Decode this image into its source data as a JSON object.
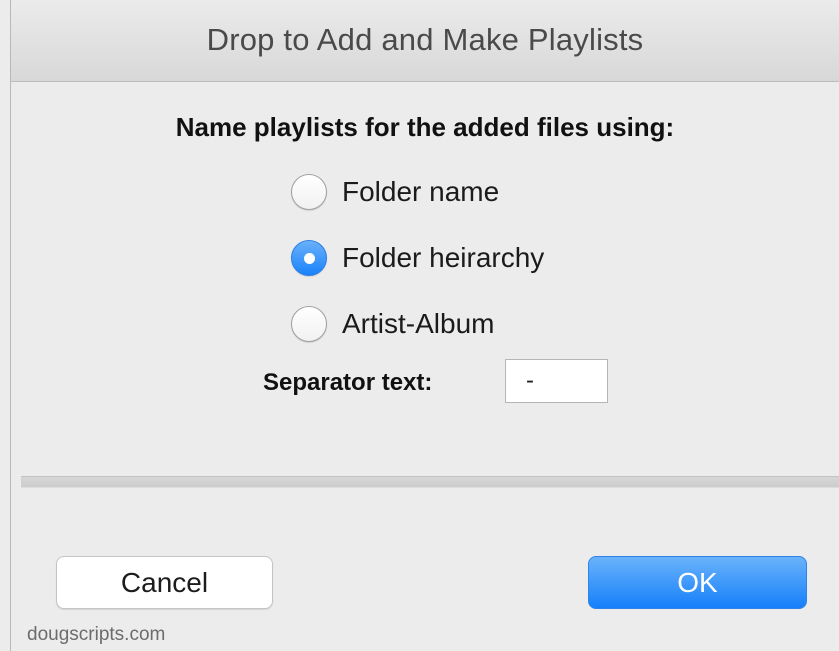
{
  "dialog": {
    "title": "Drop to Add and Make Playlists",
    "prompt": "Name playlists for the added files using:"
  },
  "options": {
    "folder_name": {
      "label": "Folder name",
      "selected": false
    },
    "folder_hierarchy": {
      "label": "Folder heirarchy",
      "selected": true
    },
    "artist_album": {
      "label": "Artist-Album",
      "selected": false
    }
  },
  "separator": {
    "label": "Separator text:",
    "value": "-"
  },
  "buttons": {
    "cancel": "Cancel",
    "ok": "OK"
  },
  "footer": {
    "text": "dougscripts.com"
  },
  "colors": {
    "accent": "#1a82fb",
    "background": "#ececec"
  }
}
